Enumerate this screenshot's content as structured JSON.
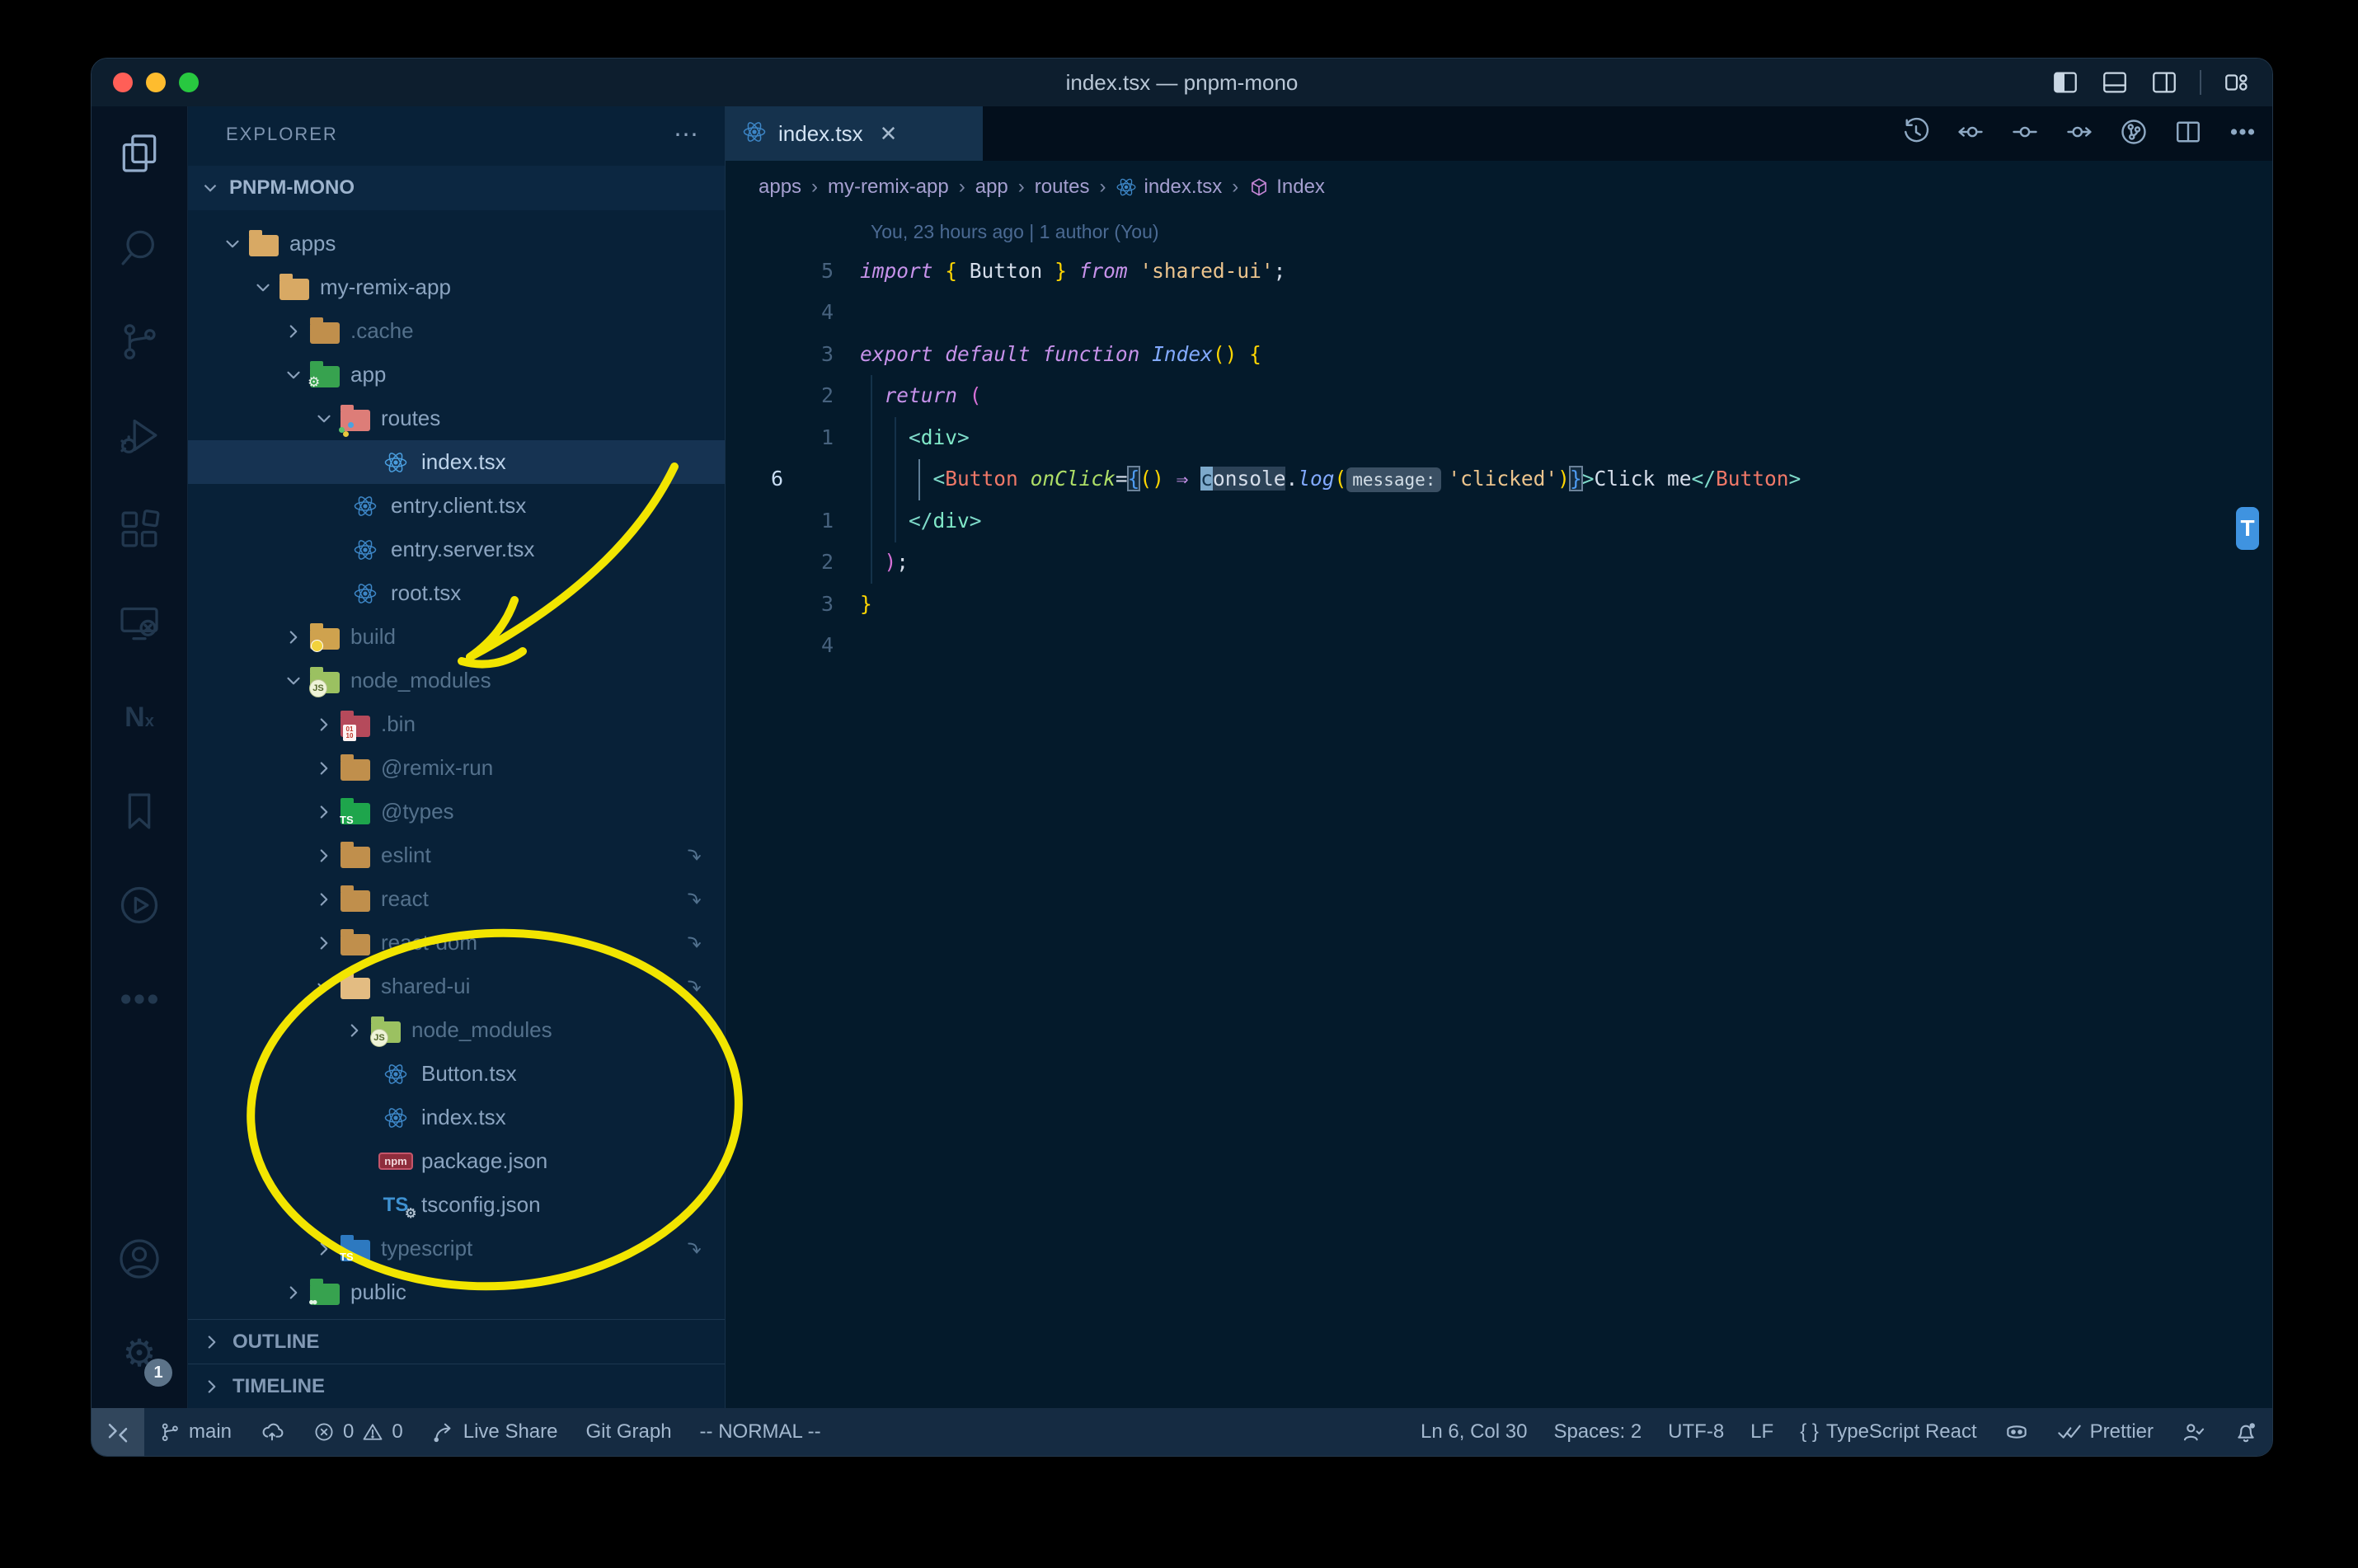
{
  "window": {
    "title": "index.tsx — pnpm-mono"
  },
  "titlebar": {
    "layout_icons": [
      "toggle-sidebar-icon",
      "toggle-panel-icon",
      "toggle-secondary-sidebar-icon",
      "customize-layout-icon"
    ]
  },
  "activity_bar": {
    "top": [
      {
        "icon": "explorer-icon",
        "active": true
      },
      {
        "icon": "search-icon"
      },
      {
        "icon": "source-control-icon"
      },
      {
        "icon": "run-debug-icon"
      },
      {
        "icon": "extensions-icon"
      },
      {
        "icon": "remote-explorer-icon"
      },
      {
        "icon": "nx-console-icon"
      },
      {
        "icon": "bookmarks-icon"
      },
      {
        "icon": "code-runner-icon"
      },
      {
        "icon": "more-icon"
      }
    ],
    "bottom": [
      {
        "icon": "accounts-icon"
      },
      {
        "icon": "settings-gear-icon",
        "badge": "1"
      }
    ]
  },
  "sidebar": {
    "header": "EXPLORER",
    "header_more": "⋯",
    "section": "PNPM-MONO",
    "tree": [
      {
        "label": "apps",
        "level": 0,
        "icon": "folder",
        "color": "#d8a964",
        "chevron": "down"
      },
      {
        "label": "my-remix-app",
        "level": 1,
        "icon": "folder",
        "color": "#d8a964",
        "chevron": "down"
      },
      {
        "label": ".cache",
        "level": 2,
        "icon": "folder",
        "color": "#c08f4c",
        "chevron": "right",
        "dim": true
      },
      {
        "label": "app",
        "level": 2,
        "icon": "folder",
        "color": "#37a24f",
        "badge": "gear",
        "chevron": "down"
      },
      {
        "label": "routes",
        "level": 3,
        "icon": "folder",
        "color": "#dd7d78",
        "badge": "dots",
        "chevron": "down"
      },
      {
        "label": "index.tsx",
        "level": 4,
        "icon": "react",
        "selected": true
      },
      {
        "label": "entry.client.tsx",
        "level": 3,
        "icon": "react"
      },
      {
        "label": "entry.server.tsx",
        "level": 3,
        "icon": "react"
      },
      {
        "label": "root.tsx",
        "level": 3,
        "icon": "react"
      },
      {
        "label": "build",
        "level": 2,
        "icon": "folder",
        "color": "#cfa24e",
        "badge": "dot",
        "chevron": "right",
        "dim": true
      },
      {
        "label": "node_modules",
        "level": 2,
        "icon": "folder",
        "color": "#9bc161",
        "badge": "js",
        "chevron": "down",
        "dim": true
      },
      {
        "label": ".bin",
        "level": 3,
        "icon": "folder",
        "color": "#b54a5b",
        "badge": "binary",
        "chevron": "right",
        "dim": true
      },
      {
        "label": "@remix-run",
        "level": 3,
        "icon": "folder",
        "color": "#c08f4c",
        "chevron": "right",
        "dim": true
      },
      {
        "label": "@types",
        "level": 3,
        "icon": "folder",
        "color": "#1ea54c",
        "badge": "ts",
        "chevron": "right",
        "dim": true
      },
      {
        "label": "eslint",
        "level": 3,
        "icon": "folder",
        "color": "#c08f4c",
        "chevron": "right",
        "dim": true,
        "symlink": true
      },
      {
        "label": "react",
        "level": 3,
        "icon": "folder",
        "color": "#c08f4c",
        "chevron": "right",
        "dim": true,
        "symlink": true
      },
      {
        "label": "react-dom",
        "level": 3,
        "icon": "folder",
        "color": "#c08f4c",
        "chevron": "right",
        "dim": true,
        "symlink": true
      },
      {
        "label": "shared-ui",
        "level": 3,
        "icon": "folder",
        "color": "#e3bc82",
        "chevron": "down",
        "dim": true,
        "symlink": true
      },
      {
        "label": "node_modules",
        "level": 4,
        "icon": "folder",
        "color": "#9bc161",
        "badge": "js",
        "chevron": "right",
        "dim": true
      },
      {
        "label": "Button.tsx",
        "level": 4,
        "icon": "react"
      },
      {
        "label": "index.tsx",
        "level": 4,
        "icon": "react"
      },
      {
        "label": "package.json",
        "level": 4,
        "icon": "npm"
      },
      {
        "label": "tsconfig.json",
        "level": 4,
        "icon": "tsconfig"
      },
      {
        "label": "typescript",
        "level": 3,
        "icon": "folder",
        "color": "#2d79c0",
        "badge": "ts",
        "chevron": "right",
        "dim": true,
        "symlink": true
      },
      {
        "label": "public",
        "level": 2,
        "icon": "folder",
        "color": "#37a24f",
        "badge": "users",
        "chevron": "right"
      }
    ],
    "panels": [
      "OUTLINE",
      "TIMELINE"
    ]
  },
  "editor": {
    "tab": {
      "label": "index.tsx",
      "icon": "react-icon",
      "close": "✕"
    },
    "actions": [
      "history-icon",
      "prev-change-icon",
      "toggle-blame-icon",
      "next-change-icon",
      "commit-graph-icon",
      "split-editor-icon",
      "more-actions-icon"
    ],
    "breadcrumbs": [
      {
        "label": "apps"
      },
      {
        "label": "my-remix-app"
      },
      {
        "label": "app"
      },
      {
        "label": "routes"
      },
      {
        "label": "index.tsx",
        "icon": "react"
      },
      {
        "label": "Index",
        "icon": "symbol-namespace"
      }
    ],
    "blame": "You, 23 hours ago | 1 author (You)",
    "t_badge": "T",
    "code": [
      {
        "gutter": "5",
        "tokens": [
          [
            "kw",
            "import"
          ],
          [
            "plain",
            " "
          ],
          [
            "b1",
            "{"
          ],
          [
            "plain",
            " Button "
          ],
          [
            "b1",
            "}"
          ],
          [
            "plain",
            " "
          ],
          [
            "kw",
            "from"
          ],
          [
            "plain",
            " "
          ],
          [
            "str",
            "'shared-ui'"
          ],
          [
            "plain",
            ";"
          ]
        ]
      },
      {
        "gutter": "4",
        "tokens": []
      },
      {
        "gutter": "3",
        "tokens": [
          [
            "kw",
            "export"
          ],
          [
            "plain",
            " "
          ],
          [
            "kw",
            "default"
          ],
          [
            "plain",
            " "
          ],
          [
            "kw",
            "function"
          ],
          [
            "plain",
            " "
          ],
          [
            "fn",
            "Index"
          ],
          [
            "b1",
            "()"
          ],
          [
            "plain",
            " "
          ],
          [
            "b1",
            "{"
          ]
        ]
      },
      {
        "gutter": "2",
        "tokens": [
          [
            "plain",
            "  "
          ],
          [
            "kw",
            "return"
          ],
          [
            "plain",
            " "
          ],
          [
            "b2",
            "("
          ]
        ]
      },
      {
        "gutter": "1",
        "tokens": [
          [
            "plain",
            "    "
          ],
          [
            "tagp",
            "<"
          ],
          [
            "tag",
            "div"
          ],
          [
            "tagp",
            ">"
          ]
        ]
      },
      {
        "gutter": "6",
        "current": true,
        "tokens": [
          [
            "plain",
            "      "
          ],
          [
            "tagp",
            "<"
          ],
          [
            "comp",
            "Button"
          ],
          [
            "plain",
            " "
          ],
          [
            "attr",
            "onClick"
          ],
          [
            "plain",
            "="
          ],
          [
            "boxb3",
            "{"
          ],
          [
            "b1",
            "()"
          ],
          [
            "plain",
            " "
          ],
          [
            "op",
            "⇒"
          ],
          [
            "plain",
            " "
          ],
          [
            "cursor",
            "c"
          ],
          [
            "hl",
            "onsole"
          ],
          [
            "plain",
            "."
          ],
          [
            "fn",
            "log"
          ],
          [
            "b1",
            "("
          ],
          [
            "inlay",
            "message:"
          ],
          [
            "str",
            "'clicked'"
          ],
          [
            "b1",
            ")"
          ],
          [
            "boxb3",
            "}"
          ],
          [
            "tagp",
            ">"
          ],
          [
            "plain",
            "Click me"
          ],
          [
            "tagp",
            "</"
          ],
          [
            "comp",
            "Button"
          ],
          [
            "tagp",
            ">"
          ]
        ]
      },
      {
        "gutter": "1",
        "tokens": [
          [
            "plain",
            "    "
          ],
          [
            "tagp",
            "</"
          ],
          [
            "tag",
            "div"
          ],
          [
            "tagp",
            ">"
          ]
        ]
      },
      {
        "gutter": "2",
        "tokens": [
          [
            "plain",
            "  "
          ],
          [
            "b2",
            ")"
          ],
          [
            "plain",
            ";"
          ]
        ]
      },
      {
        "gutter": "3",
        "tokens": [
          [
            "b1",
            "}"
          ]
        ]
      },
      {
        "gutter": "4",
        "tokens": []
      }
    ]
  },
  "status_bar": {
    "left": [
      {
        "icon": "remote-icon",
        "remote": true
      },
      {
        "icon": "git-branch-icon",
        "label": "main"
      },
      {
        "icon": "cloud-upload-icon"
      },
      {
        "icon": "error-icon",
        "label": "0",
        "icon2": "warning-icon",
        "label2": "0"
      },
      {
        "icon": "live-share-icon",
        "label": "Live Share"
      },
      {
        "label": "Git Graph"
      },
      {
        "label": "-- NORMAL --"
      }
    ],
    "right": [
      {
        "label": "Ln 6, Col 30"
      },
      {
        "label": "Spaces: 2"
      },
      {
        "label": "UTF-8"
      },
      {
        "label": "LF"
      },
      {
        "icon": "braces-icon",
        "label": "TypeScript React"
      },
      {
        "icon": "copilot-icon"
      },
      {
        "icon": "prettier-check-icon",
        "label": "Prettier"
      },
      {
        "icon": "person-check-icon"
      },
      {
        "icon": "bell-icon"
      }
    ]
  },
  "annotations": {
    "color": "#f2e500",
    "shapes": [
      "hand-drawn-arrow",
      "hand-drawn-ellipse"
    ]
  },
  "colors": {
    "window_bg": "#041a2b",
    "sidebar_bg": "#082138",
    "statusbar_bg": "#152b42",
    "accent_yellow": "#f2e500",
    "selection_row": "#163352",
    "active_tab": "#15324d",
    "traffic_red": "#ff5f57",
    "traffic_yellow": "#febc2e",
    "traffic_green": "#28c840",
    "bracket_gold": "#ffd602",
    "bracket_pink": "#d670d6",
    "bracket_blue": "#4e9bf0",
    "keyword": "#c792ea",
    "string": "#ecc48d",
    "function": "#82aaff"
  }
}
